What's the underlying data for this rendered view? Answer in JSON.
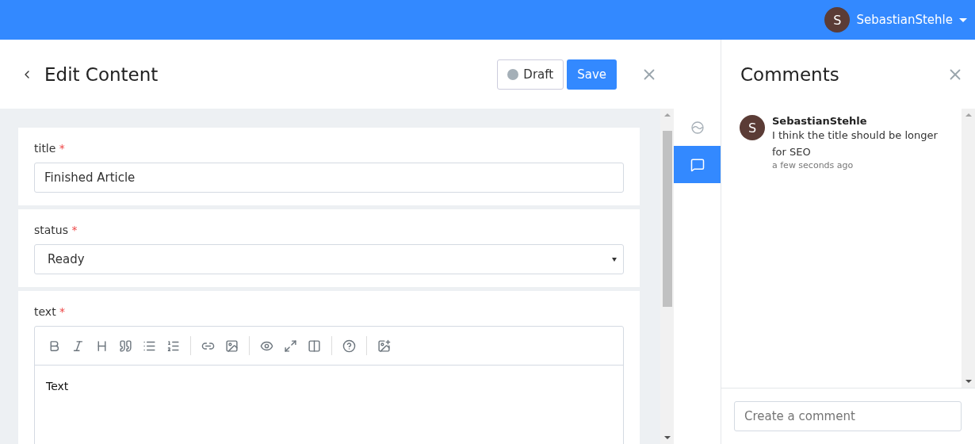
{
  "topbar": {
    "user_initial": "S",
    "user_name": "SebastianStehle"
  },
  "header": {
    "title": "Edit Content",
    "status": {
      "label": "Draft",
      "color": "#a4afb7"
    },
    "save": "Save"
  },
  "fields": [
    {
      "kind": "input",
      "label": "title",
      "required_mark": "*",
      "value": "Finished Article"
    },
    {
      "kind": "select",
      "label": "status",
      "required_mark": "*",
      "value": "Ready"
    },
    {
      "kind": "editor",
      "label": "text",
      "required_mark": "*",
      "value": "Text"
    }
  ],
  "rail": [
    {
      "kind": "history",
      "selected": false
    },
    {
      "kind": "comments",
      "selected": true
    }
  ],
  "comments_panel": {
    "title": "Comments",
    "comments": [
      {
        "initial": "S",
        "author": "SebastianStehle",
        "text": "I think the title should be longer for SEO",
        "time": "a few seconds ago"
      }
    ],
    "placeholder": "Create a comment"
  }
}
